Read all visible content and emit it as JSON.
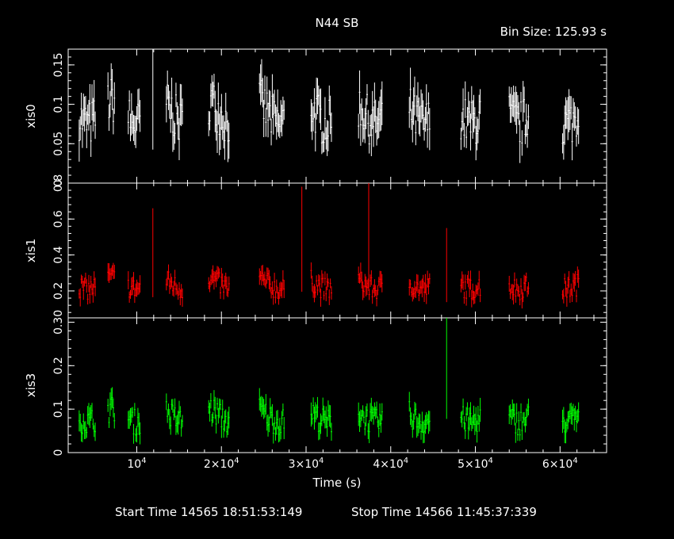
{
  "title": "N44 SB",
  "bin_size_label": "Bin Size: 125.93 s",
  "start_time_label": "Start Time 14565 18:51:53:149",
  "stop_time_label": "Stop Time 14566 11:45:37:339",
  "chart_data": {
    "type": "scatter",
    "title": "N44 SB",
    "xlabel": "Time (s)",
    "xlim": [
      1900,
      65500
    ],
    "x_tick_labels": [
      "10^4",
      "2×10^4",
      "3×10^4",
      "4×10^4",
      "5×10^4",
      "6×10^4"
    ],
    "x_ticks": [
      10000,
      20000,
      30000,
      40000,
      50000,
      60000
    ],
    "segments": [
      [
        3200,
        5100
      ],
      [
        6600,
        7400
      ],
      [
        9000,
        10400
      ],
      [
        13500,
        15500
      ],
      [
        18500,
        21000
      ],
      [
        24500,
        27500
      ],
      [
        30600,
        33000
      ],
      [
        36200,
        39000
      ],
      [
        42200,
        44600
      ],
      [
        48300,
        50600
      ],
      [
        54000,
        56300
      ],
      [
        60300,
        62300
      ]
    ],
    "spikes": [
      {
        "panel": "xis0",
        "x": 11900,
        "y": 0.17
      },
      {
        "panel": "xis1",
        "x": 11900,
        "y": 0.66
      },
      {
        "panel": "xis1",
        "x": 29500,
        "y": 0.78
      },
      {
        "panel": "xis1",
        "x": 37400,
        "y": 0.8
      },
      {
        "panel": "xis1",
        "x": 46600,
        "y": 0.55
      },
      {
        "panel": "xis3",
        "x": 46600,
        "y": 0.31
      }
    ],
    "panels": [
      {
        "ylabel": "xis0",
        "color": "#ffffff",
        "ylim": [
          0,
          0.17
        ],
        "y_ticks": [
          0,
          0.05,
          0.1,
          0.15
        ],
        "y_tick_labels": [
          "0",
          "0.05",
          "0.1",
          "0.15"
        ],
        "mean": 0.09,
        "spread": 0.025,
        "err": 0.02
      },
      {
        "ylabel": "xis1",
        "color": "#ff0000",
        "ylim": [
          0.05,
          0.8
        ],
        "y_ticks": [
          0.2,
          0.4,
          0.6,
          0.8
        ],
        "y_tick_labels": [
          "0.2",
          "0.4",
          "0.6",
          "0.8"
        ],
        "mean": 0.24,
        "spread": 0.05,
        "err": 0.04
      },
      {
        "ylabel": "xis3",
        "color": "#00ff00",
        "ylim": [
          0,
          0.31
        ],
        "y_ticks": [
          0,
          0.1,
          0.2,
          0.3
        ],
        "y_tick_labels": [
          "0",
          "0.1",
          "0.2",
          "0.30"
        ],
        "mean": 0.085,
        "spread": 0.025,
        "err": 0.02
      }
    ]
  }
}
